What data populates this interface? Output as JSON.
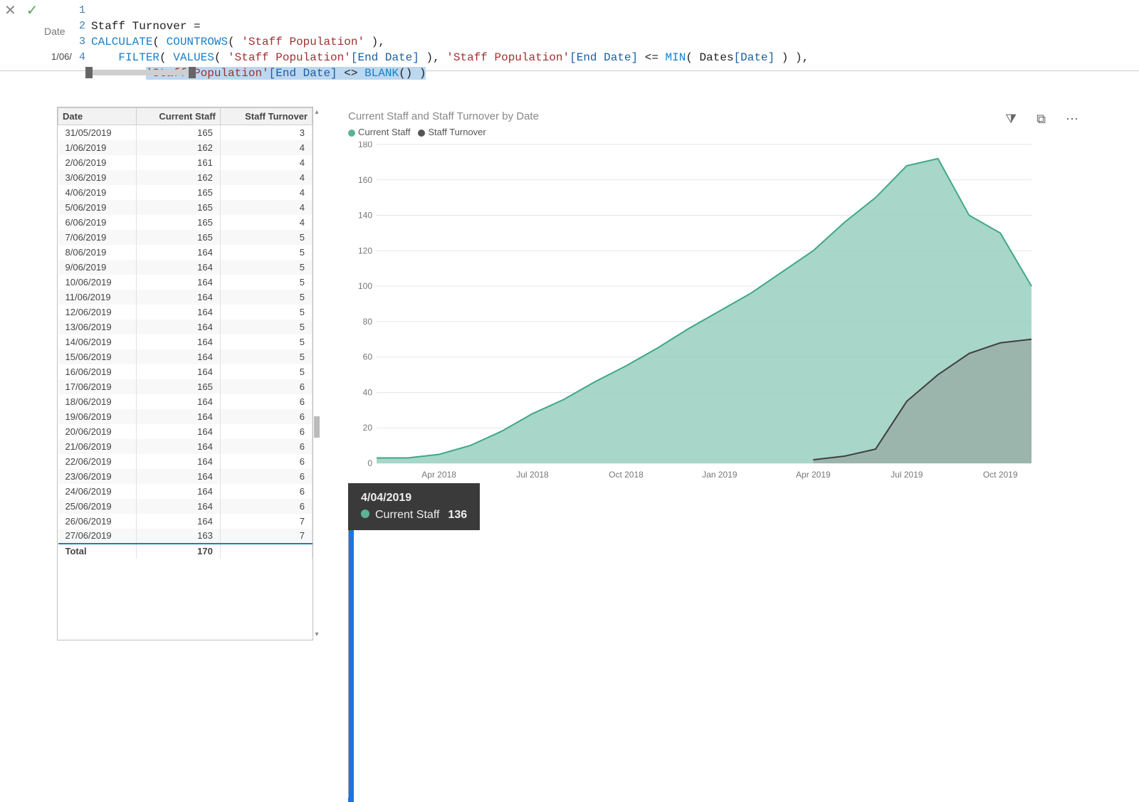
{
  "formula": {
    "cancel_glyph": "✕",
    "commit_glyph": "✓",
    "left_label_fragment": "Date",
    "left_value_fragment": "1/06/",
    "lines": [
      "1",
      "2",
      "3",
      "4"
    ],
    "code": {
      "l1_a": "Staff Turnover =",
      "l2_a": "CALCULATE",
      "l2_b": "( ",
      "l2_c": "COUNTROWS",
      "l2_d": "( ",
      "l2_e": "'Staff Population'",
      "l2_f": " ),",
      "l3_a": "    ",
      "l3_b": "FILTER",
      "l3_c": "( ",
      "l3_d": "VALUES",
      "l3_e": "( ",
      "l3_f": "'Staff Population'",
      "l3_g": "[End Date]",
      "l3_h": " ), ",
      "l3_i": "'Staff Population'",
      "l3_j": "[End Date]",
      "l3_k": " <= ",
      "l3_l": "MIN",
      "l3_m": "( ",
      "l3_n": "Dates",
      "l3_o": "[Date]",
      "l3_p": " ) ),",
      "l4_a": "        ",
      "l4_b": "'Staff Population'",
      "l4_c": "[End Date]",
      "l4_d": " <> ",
      "l4_e": "BLANK",
      "l4_f": "() )"
    }
  },
  "table": {
    "headers": {
      "date": "Date",
      "current": "Current Staff",
      "turnover": "Staff Turnover"
    },
    "rows": [
      {
        "d": "31/05/2019",
        "c": 165,
        "t": 3
      },
      {
        "d": "1/06/2019",
        "c": 162,
        "t": 4
      },
      {
        "d": "2/06/2019",
        "c": 161,
        "t": 4
      },
      {
        "d": "3/06/2019",
        "c": 162,
        "t": 4
      },
      {
        "d": "4/06/2019",
        "c": 165,
        "t": 4
      },
      {
        "d": "5/06/2019",
        "c": 165,
        "t": 4
      },
      {
        "d": "6/06/2019",
        "c": 165,
        "t": 4
      },
      {
        "d": "7/06/2019",
        "c": 165,
        "t": 5
      },
      {
        "d": "8/06/2019",
        "c": 164,
        "t": 5
      },
      {
        "d": "9/06/2019",
        "c": 164,
        "t": 5
      },
      {
        "d": "10/06/2019",
        "c": 164,
        "t": 5
      },
      {
        "d": "11/06/2019",
        "c": 164,
        "t": 5
      },
      {
        "d": "12/06/2019",
        "c": 164,
        "t": 5
      },
      {
        "d": "13/06/2019",
        "c": 164,
        "t": 5
      },
      {
        "d": "14/06/2019",
        "c": 164,
        "t": 5
      },
      {
        "d": "15/06/2019",
        "c": 164,
        "t": 5
      },
      {
        "d": "16/06/2019",
        "c": 164,
        "t": 5
      },
      {
        "d": "17/06/2019",
        "c": 165,
        "t": 6
      },
      {
        "d": "18/06/2019",
        "c": 164,
        "t": 6
      },
      {
        "d": "19/06/2019",
        "c": 164,
        "t": 6
      },
      {
        "d": "20/06/2019",
        "c": 164,
        "t": 6
      },
      {
        "d": "21/06/2019",
        "c": 164,
        "t": 6
      },
      {
        "d": "22/06/2019",
        "c": 164,
        "t": 6
      },
      {
        "d": "23/06/2019",
        "c": 164,
        "t": 6
      },
      {
        "d": "24/06/2019",
        "c": 164,
        "t": 6
      },
      {
        "d": "25/06/2019",
        "c": 164,
        "t": 6
      },
      {
        "d": "26/06/2019",
        "c": 164,
        "t": 7
      },
      {
        "d": "27/06/2019",
        "c": 163,
        "t": 7
      }
    ],
    "total_label": "Total",
    "total_value": 170
  },
  "chart_toolbar": {
    "filter": "⧩",
    "focus": "⧉",
    "more": "⋯"
  },
  "chart_data": {
    "type": "area",
    "title": "Current Staff and Staff Turnover by Date",
    "ylabel": "",
    "xlabel": "",
    "ylim": [
      0,
      180
    ],
    "yticks": [
      0,
      20,
      40,
      60,
      80,
      100,
      120,
      140,
      160,
      180
    ],
    "xticks": [
      "Apr 2018",
      "Jul 2018",
      "Oct 2018",
      "Jan 2019",
      "Apr 2019",
      "Jul 2019",
      "Oct 2019"
    ],
    "series": [
      {
        "name": "Current Staff",
        "color": "#59b498",
        "x_months": [
          2,
          3,
          4,
          5,
          6,
          7,
          8,
          9,
          10,
          11,
          12,
          13,
          14,
          15,
          16,
          17,
          18,
          19,
          20,
          21,
          22,
          23
        ],
        "values": [
          3,
          3,
          5,
          10,
          18,
          28,
          36,
          46,
          55,
          65,
          76,
          86,
          96,
          108,
          120,
          136,
          150,
          168,
          172,
          140,
          130,
          100
        ]
      },
      {
        "name": "Staff Turnover",
        "color": "#555555",
        "x_months": [
          16,
          17,
          18,
          19,
          20,
          21,
          22,
          23
        ],
        "values": [
          2,
          4,
          8,
          35,
          50,
          62,
          68,
          70
        ]
      }
    ],
    "legend": {
      "s0": "Current Staff",
      "s1": "Staff Turnover"
    },
    "tooltip": {
      "date": "4/04/2019",
      "series": "Current Staff",
      "value": 136
    },
    "selection": {
      "from_month": 13.3,
      "to_month": 18.5
    }
  }
}
